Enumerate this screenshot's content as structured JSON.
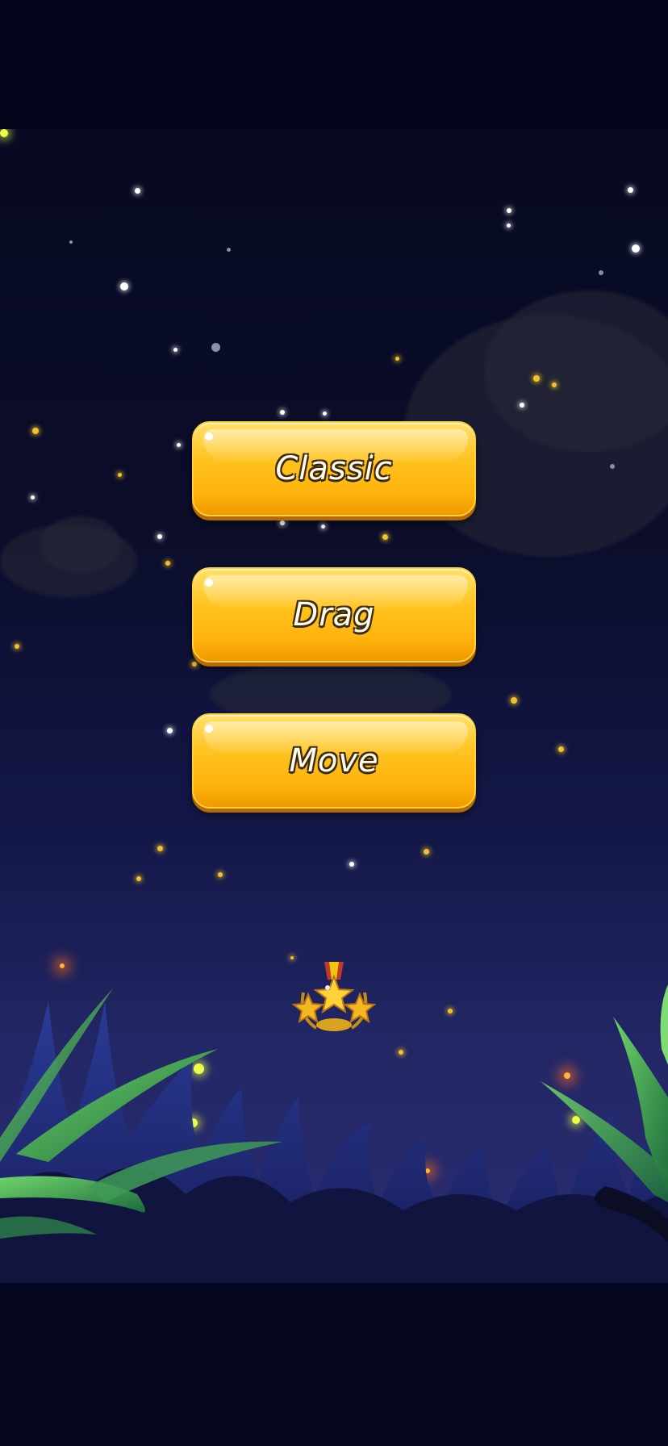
{
  "menu": {
    "buttons": [
      {
        "label": "Classic"
      },
      {
        "label": "Drag"
      },
      {
        "label": "Move"
      }
    ]
  },
  "decor": {
    "medal_icon": "three-star-medal",
    "theme_colors": {
      "button_gold": "#ffc31f",
      "button_outline": "#3a2a10",
      "night_sky": "#0b0d2a",
      "firefly": "#f2c22a"
    }
  }
}
